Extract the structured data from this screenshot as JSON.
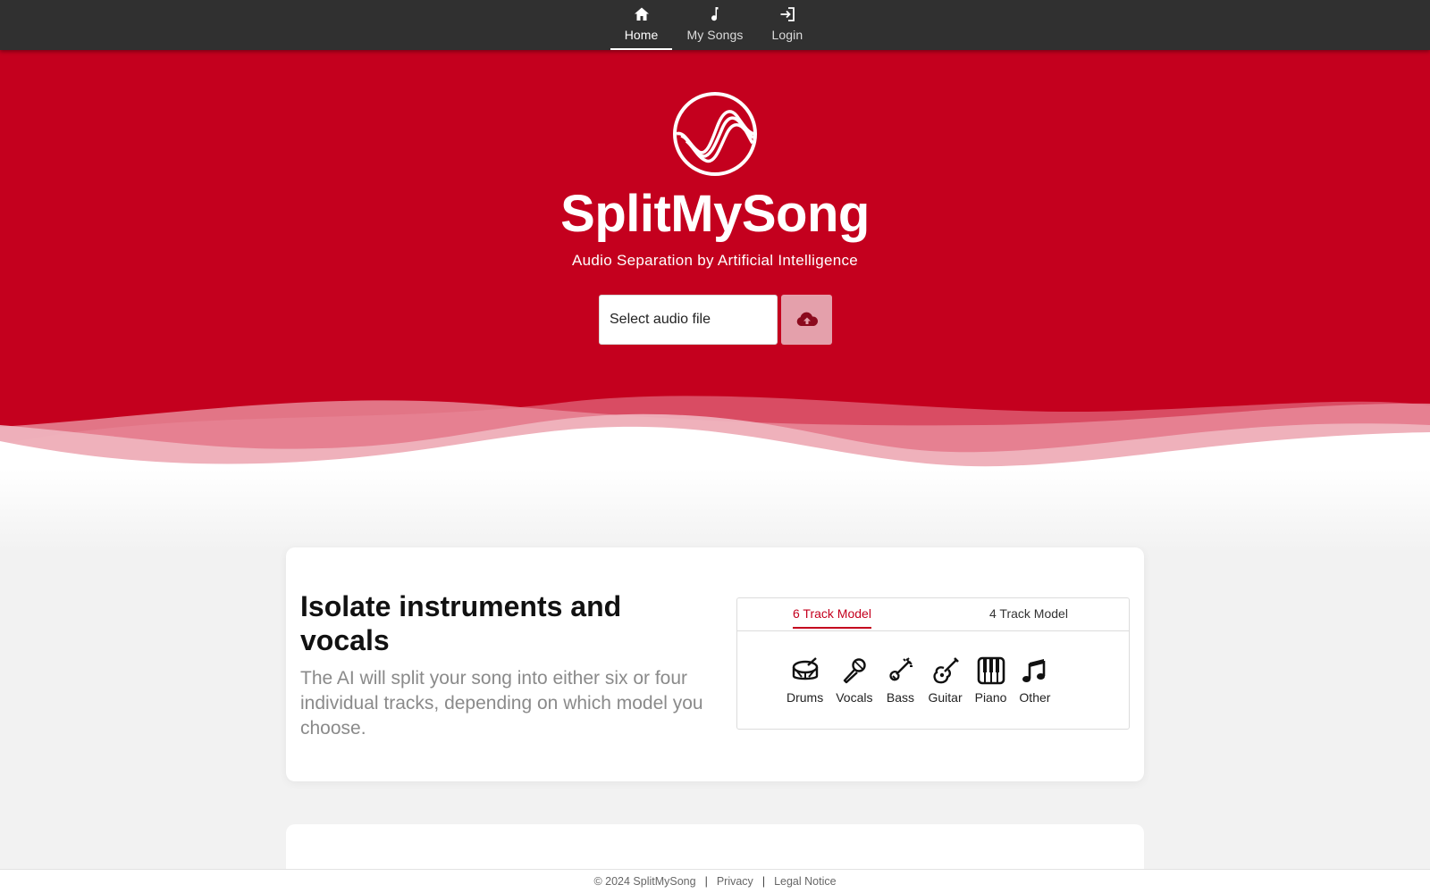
{
  "nav": {
    "items": [
      {
        "label": "Home",
        "icon": "home-icon",
        "active": true
      },
      {
        "label": "My Songs",
        "icon": "music-note-icon",
        "active": false
      },
      {
        "label": "Login",
        "icon": "login-icon",
        "active": false
      }
    ]
  },
  "hero": {
    "brand": "SplitMySong",
    "tagline": "Audio Separation by Artificial Intelligence",
    "file_input_label": "Select audio file",
    "upload_icon": "cloud-upload-icon",
    "bg_color": "#c4001e"
  },
  "feature": {
    "heading": "Isolate instruments and vocals",
    "description": "The AI will split your song into either six or four individual tracks, depending on which model you choose.",
    "tabs": [
      {
        "label": "6 Track Model",
        "active": true
      },
      {
        "label": "4 Track Model",
        "active": false
      }
    ],
    "instruments": [
      {
        "label": "Drums",
        "icon": "drum-icon"
      },
      {
        "label": "Vocals",
        "icon": "microphone-icon"
      },
      {
        "label": "Bass",
        "icon": "bass-guitar-icon"
      },
      {
        "label": "Guitar",
        "icon": "guitar-icon"
      },
      {
        "label": "Piano",
        "icon": "piano-icon"
      },
      {
        "label": "Other",
        "icon": "music-notes-icon"
      }
    ]
  },
  "footer": {
    "copyright": "© 2024 SplitMySong",
    "privacy": "Privacy",
    "legal": "Legal Notice"
  }
}
